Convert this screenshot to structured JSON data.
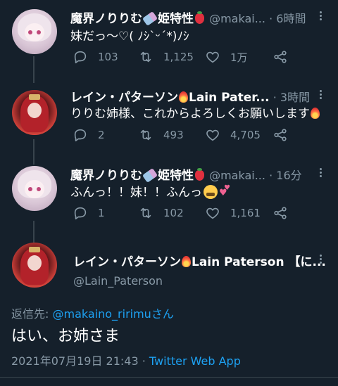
{
  "tweets": [
    {
      "name": "魔界ノりりむ",
      "name_suffix": "姫特性",
      "handle": "@makai...",
      "dot": "·",
      "time": "6時間",
      "text": "妹だっ〜♡( ﾉｼ`ᵕ´*)ﾉｼ",
      "replies": "103",
      "retweets": "1,125",
      "likes": "1万"
    },
    {
      "name": "レイン・パターソン",
      "name_en": "Lain Pater...",
      "dot": "·",
      "time": "3時間",
      "text": "りりむ姉様、これからよろしくお願いします",
      "replies": "2",
      "retweets": "493",
      "likes": "4,705"
    },
    {
      "name": "魔界ノりりむ",
      "name_suffix": "姫特性",
      "handle": "@makai...",
      "dot": "·",
      "time": "16分",
      "text": "ふんっ！！妹！！ふんっ",
      "replies": "1",
      "retweets": "102",
      "likes": "1,161"
    }
  ],
  "main_tweet": {
    "name": "レイン・パターソン",
    "name_en": "Lain Paterson 【に...",
    "handle": "@Lain_Paterson",
    "reply_prefix": "返信先: ",
    "reply_to": "@makaino_ririmu",
    "reply_suffix": "さん",
    "text": "はい、お姉さま",
    "timestamp": "2021年07月19日 21:43",
    "dot": "·",
    "source": "Twitter Web App"
  },
  "colors": {
    "background": "#15202b",
    "secondary_text": "#8899a6",
    "link": "#1da1f2",
    "divider": "#38444d"
  },
  "icons": [
    "reply-icon",
    "retweet-icon",
    "like-icon",
    "share-icon",
    "more-icon"
  ]
}
